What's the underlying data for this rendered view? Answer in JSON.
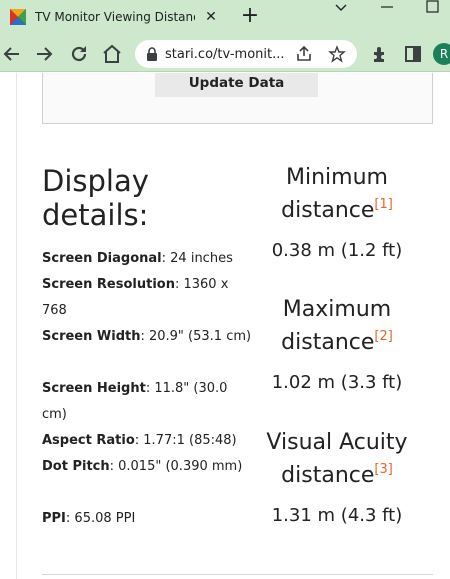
{
  "browser": {
    "tab_title": "TV Monitor Viewing Distance",
    "tab_close": "✕",
    "new_tab": "+",
    "url": "stari.co/tv-monit...",
    "profile_initial": "R",
    "icons": [
      "favicon-icon",
      "back-icon",
      "forward-icon",
      "reload-icon",
      "home-icon",
      "lock-icon",
      "share-icon",
      "star-icon",
      "extensions-icon",
      "sidepanel-icon",
      "chevron-down-icon",
      "minimize-icon",
      "maximize-icon"
    ],
    "accent_color": "#cde8cc"
  },
  "page": {
    "update_button": "Update Data",
    "display_title": "Display details:",
    "specs": [
      {
        "label": "Screen Diagonal",
        "value": ": 24 inches"
      },
      {
        "label": "Screen Resolution",
        "value": ": 1360 x 768"
      },
      {
        "label": "Screen Width",
        "value": ": 20.9\" (53.1 cm)"
      },
      {
        "label": "Screen Height",
        "value": ": 11.8\" (30.0 cm)"
      },
      {
        "label": "Aspect Ratio",
        "value": ": 1.77:1 (85:48)"
      },
      {
        "label": "Dot Pitch",
        "value": ": 0.015\" (0.390 mm)"
      },
      {
        "label": "PPI",
        "value": ": 65.08 PPI"
      }
    ],
    "metrics": [
      {
        "label": "Minimum distance",
        "ref": "[1]",
        "value": "0.38 m (1.2 ft)"
      },
      {
        "label": "Maximum distance",
        "ref": "[2]",
        "value": "1.02 m (3.3 ft)"
      },
      {
        "label": "Visual Acuity distance",
        "ref": "[3]",
        "value": "1.31 m (4.3 ft)"
      }
    ],
    "citation_color": "#e06a2b"
  }
}
